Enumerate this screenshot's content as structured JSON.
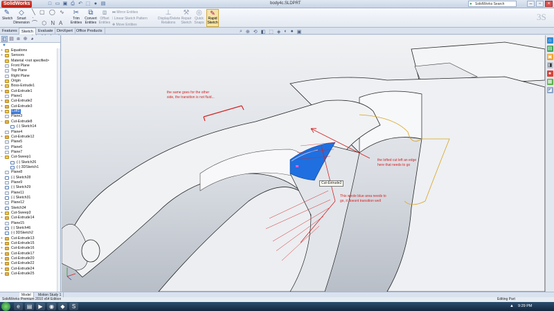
{
  "app": {
    "logo": "SolidWorks",
    "document_title": "body4c.SLDPRT",
    "search_text": "SolidWorks Search"
  },
  "quick_access": [
    "new-icon",
    "open-icon",
    "save-icon",
    "print-icon",
    "undo-icon",
    "select-icon",
    "rebuild-icon",
    "options-icon"
  ],
  "ribbon": {
    "sketch": "Sketch",
    "smart_dimension_1": "Smart",
    "smart_dimension_2": "Dimension",
    "trim_1": "Trim",
    "trim_2": "Entities",
    "convert_1": "Convert",
    "convert_2": "Entities",
    "offset_1": "Offset",
    "offset_2": "Entities",
    "mirror": "Mirror Entities",
    "linear_pattern": "Linear Sketch Pattern",
    "move": "Move Entities",
    "display_1": "Display/Delete",
    "display_2": "Relations",
    "repair_1": "Repair",
    "repair_2": "Sketch",
    "quick_1": "Quick",
    "quick_2": "Snaps",
    "rapid_1": "Rapid",
    "rapid_2": "Sketch"
  },
  "command_tabs": [
    "Features",
    "Sketch",
    "Evaluate",
    "DimXpert",
    "Office Products"
  ],
  "active_command_tab": "Sketch",
  "feature_tree": [
    {
      "label": "Equations",
      "icon": "equations-icon",
      "expand": "+",
      "level": 0
    },
    {
      "label": "Sensors",
      "icon": "sensors-icon",
      "expand": "+",
      "level": 0
    },
    {
      "label": "Material <not specified>",
      "icon": "material-icon",
      "expand": "",
      "level": 0
    },
    {
      "label": "Front Plane",
      "icon": "plane-icon",
      "expand": "",
      "level": 0
    },
    {
      "label": "Top Plane",
      "icon": "plane-icon",
      "expand": "",
      "level": 0
    },
    {
      "label": "Right Plane",
      "icon": "plane-icon",
      "expand": "",
      "level": 0
    },
    {
      "label": "Origin",
      "icon": "origin-icon",
      "expand": "",
      "level": 0
    },
    {
      "label": "Boss-Extrude1",
      "icon": "extrude-icon",
      "expand": "+",
      "level": 0
    },
    {
      "label": "Cut-Extrude1",
      "icon": "cut-icon",
      "expand": "+",
      "level": 0
    },
    {
      "label": "Plane1",
      "icon": "plane-icon",
      "expand": "",
      "level": 0
    },
    {
      "label": "Cut-Extrude2",
      "icon": "cut-icon",
      "expand": "+",
      "level": 0
    },
    {
      "label": "Cut-Extrude3",
      "icon": "cut-icon",
      "expand": "+",
      "level": 0
    },
    {
      "label": "Loft1",
      "icon": "loft-icon",
      "expand": "+",
      "level": 0,
      "selected": true
    },
    {
      "label": "Plane3",
      "icon": "plane-icon",
      "expand": "",
      "level": 0
    },
    {
      "label": "Cut-Extrude8",
      "icon": "cut-icon",
      "expand": "−",
      "level": 0
    },
    {
      "label": "(-) Sketch14",
      "icon": "sketch-icon",
      "expand": "",
      "level": 1
    },
    {
      "label": "Plane4",
      "icon": "plane-icon",
      "expand": "",
      "level": 0
    },
    {
      "label": "Cut-Extrude12",
      "icon": "cut-icon",
      "expand": "+",
      "level": 0
    },
    {
      "label": "Plane5",
      "icon": "plane-icon",
      "expand": "",
      "level": 0
    },
    {
      "label": "Plane6",
      "icon": "plane-icon",
      "expand": "",
      "level": 0
    },
    {
      "label": "Plane7",
      "icon": "plane-icon",
      "expand": "",
      "level": 0
    },
    {
      "label": "Cut-Sweep1",
      "icon": "sweep-icon",
      "expand": "−",
      "level": 0
    },
    {
      "label": "(-) Sketch26",
      "icon": "sketch-icon",
      "expand": "",
      "level": 1
    },
    {
      "label": "(-) 3DSketch1",
      "icon": "sketch-icon",
      "expand": "",
      "level": 1
    },
    {
      "label": "Plane8",
      "icon": "plane-icon",
      "expand": "",
      "level": 0
    },
    {
      "label": "(-) Sketch28",
      "icon": "sketch-icon",
      "expand": "",
      "level": 0
    },
    {
      "label": "Plane9",
      "icon": "plane-icon",
      "expand": "",
      "level": 0
    },
    {
      "label": "(-) Sketch29",
      "icon": "sketch-icon",
      "expand": "",
      "level": 0
    },
    {
      "label": "Plane11",
      "icon": "plane-icon",
      "expand": "",
      "level": 0
    },
    {
      "label": "(-) Sketch31",
      "icon": "sketch-icon",
      "expand": "",
      "level": 0
    },
    {
      "label": "Plane12",
      "icon": "plane-icon",
      "expand": "",
      "level": 0
    },
    {
      "label": "Sketch34",
      "icon": "sketch-icon",
      "expand": "",
      "level": 0
    },
    {
      "label": "Cut-Sweep3",
      "icon": "sweep-icon",
      "expand": "+",
      "level": 0
    },
    {
      "label": "Cut-Extrude14",
      "icon": "cut-icon",
      "expand": "+",
      "level": 0
    },
    {
      "label": "Plane15",
      "icon": "plane-icon",
      "expand": "",
      "level": 0
    },
    {
      "label": "(-) Sketch46",
      "icon": "sketch-icon",
      "expand": "",
      "level": 0
    },
    {
      "label": "(-) 3DSketch2",
      "icon": "sketch-icon",
      "expand": "",
      "level": 0
    },
    {
      "label": "Cut-Extrude13",
      "icon": "cut-icon",
      "expand": "+",
      "level": 0
    },
    {
      "label": "Cut-Extrude15",
      "icon": "cut-icon",
      "expand": "+",
      "level": 0
    },
    {
      "label": "Cut-Extrude16",
      "icon": "cut-icon",
      "expand": "+",
      "level": 0
    },
    {
      "label": "Cut-Extrude17",
      "icon": "cut-icon",
      "expand": "+",
      "level": 0
    },
    {
      "label": "Cut-Extrude20",
      "icon": "cut-icon",
      "expand": "+",
      "level": 0
    },
    {
      "label": "Cut-Extrude22",
      "icon": "cut-icon",
      "expand": "+",
      "level": 0
    },
    {
      "label": "Cut-Extrude24",
      "icon": "cut-icon",
      "expand": "+",
      "level": 0
    },
    {
      "label": "Cut-Extrude25",
      "icon": "cut-icon",
      "expand": "+",
      "level": 0
    }
  ],
  "annotations": {
    "note1_line1": "the same goes for the other",
    "note1_line2": "side, the transition is not fluid...",
    "note2_line1": "the lofted cut left an edge",
    "note2_line2": "here that needs to go",
    "note3_line1": "This whole blue area needs to",
    "note3_line2": "go, it doesnt transition well"
  },
  "tooltip": "Cut-Extrude2",
  "model_tabs": [
    "Model",
    "Motion Study 1"
  ],
  "status": {
    "left": "SolidWorks Premium 2010 x64 Edition",
    "right": "Editing Part"
  },
  "clock": "9:29 PM",
  "colors": {
    "annotation_red": "#d32424",
    "highlight_blue": "#1f6fe0",
    "edge_yellow": "#d8a21c"
  }
}
